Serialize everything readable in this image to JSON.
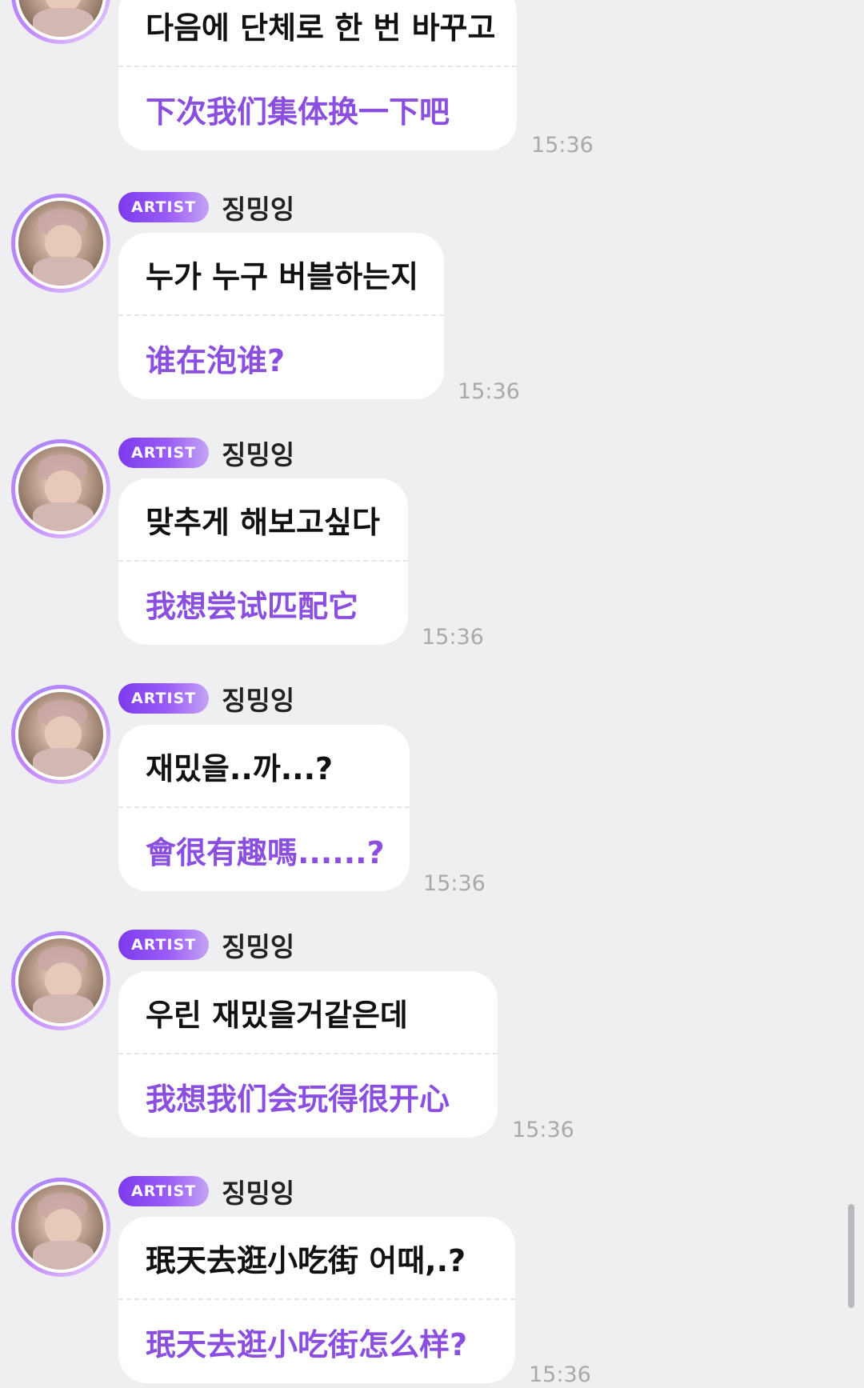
{
  "messages": [
    {
      "badge": "",
      "name": "",
      "original": "다음에 단체로 한 번 바꾸고",
      "translation": "下次我们集体换一下吧",
      "time": "15:36"
    },
    {
      "badge": "ARTIST",
      "name": "징밍잉",
      "original": "누가 누구 버블하는지",
      "translation": "谁在泡谁?",
      "time": "15:36"
    },
    {
      "badge": "ARTIST",
      "name": "징밍잉",
      "original": "맞추게 해보고싶다",
      "translation": "我想尝试匹配它",
      "time": "15:36"
    },
    {
      "badge": "ARTIST",
      "name": "징밍잉",
      "original": "재밌을..까...?",
      "translation": "會很有趣嗎......?",
      "time": "15:36"
    },
    {
      "badge": "ARTIST",
      "name": "징밍잉",
      "original": "우린 재밌을거같은데",
      "translation": "我想我们会玩得很开心",
      "time": "15:36"
    },
    {
      "badge": "ARTIST",
      "name": "징밍잉",
      "original": "珉天去逛小吃街 어때,.?",
      "translation": "珉天去逛小吃街怎么样?",
      "time": "15:36"
    }
  ]
}
